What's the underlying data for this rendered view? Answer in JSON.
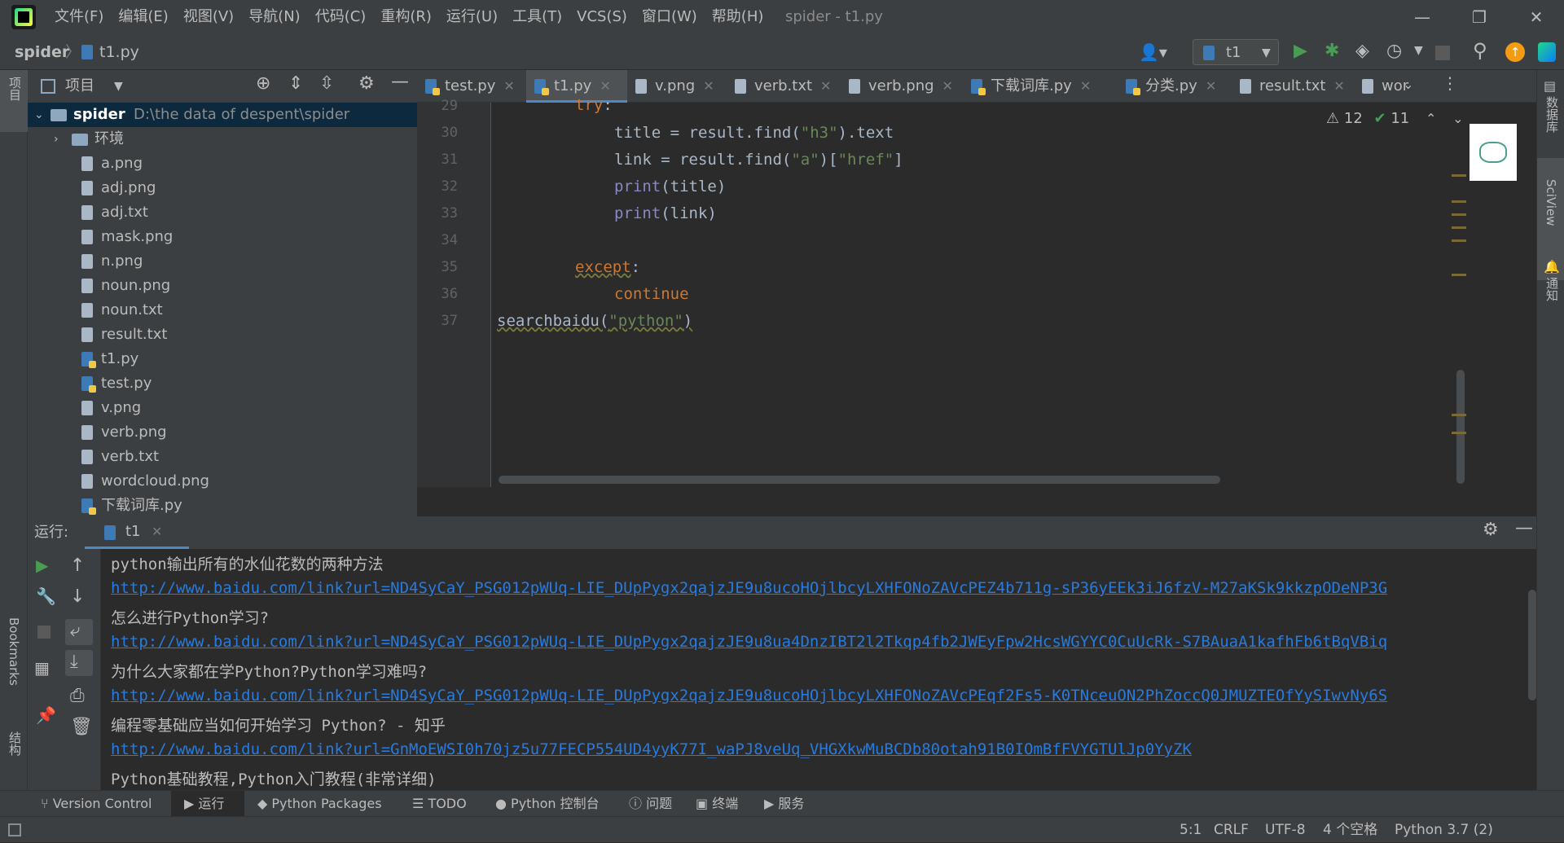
{
  "window": {
    "title": "spider - t1.py",
    "menu": [
      "文件(F)",
      "编辑(E)",
      "视图(V)",
      "导航(N)",
      "代码(C)",
      "重构(R)",
      "运行(U)",
      "工具(T)",
      "VCS(S)",
      "窗口(W)",
      "帮助(H)"
    ]
  },
  "nav": {
    "project": "spider",
    "file": "t1.py",
    "run_config": "t1"
  },
  "left_strip": {
    "project_label": "项目",
    "bookmarks_label": "Bookmarks",
    "structure_label": "结构"
  },
  "right_strip": {
    "db_label": "数据库",
    "sciview_label": "SciView",
    "notify_label": "通知"
  },
  "project_panel": {
    "title": "项目",
    "root_name": "spider",
    "root_path": "D:\\the data of despent\\spider",
    "folder": "环境",
    "files": [
      {
        "name": "a.png",
        "py": false
      },
      {
        "name": "adj.png",
        "py": false
      },
      {
        "name": "adj.txt",
        "py": false
      },
      {
        "name": "mask.png",
        "py": false
      },
      {
        "name": "n.png",
        "py": false
      },
      {
        "name": "noun.png",
        "py": false
      },
      {
        "name": "noun.txt",
        "py": false
      },
      {
        "name": "result.txt",
        "py": false
      },
      {
        "name": "t1.py",
        "py": true
      },
      {
        "name": "test.py",
        "py": true
      },
      {
        "name": "v.png",
        "py": false
      },
      {
        "name": "verb.png",
        "py": false
      },
      {
        "name": "verb.txt",
        "py": false
      },
      {
        "name": "wordcloud.png",
        "py": false
      },
      {
        "name": "下载词库.py",
        "py": true
      }
    ]
  },
  "tabs": [
    "test.py",
    "t1.py",
    "v.png",
    "verb.txt",
    "verb.png",
    "下载词库.py",
    "分类.py",
    "result.txt",
    "wor"
  ],
  "active_tab": "t1.py",
  "inspections": {
    "warnings": "12",
    "ok": "11"
  },
  "code": {
    "line_numbers": [
      "29",
      "30",
      "31",
      "32",
      "33",
      "34",
      "35",
      "36",
      "37"
    ]
  },
  "run": {
    "label": "运行:",
    "tab": "t1",
    "output": [
      {
        "kind": "txt",
        "text": "python输出所有的水仙花数的两种方法"
      },
      {
        "kind": "link",
        "text": "http://www.baidu.com/link?url=ND4SyCaY_PSG012pWUq-LIE_DUpPygx2qajzJE9u8ucoHOjlbcyLXHFONoZAVcPEZ4b711g-sP36yEEk3iJ6fzV-M27aKSk9kkzpODeNP3G"
      },
      {
        "kind": "txt",
        "text": "怎么进行Python学习?"
      },
      {
        "kind": "link",
        "text": "http://www.baidu.com/link?url=ND4SyCaY_PSG012pWUq-LIE_DUpPygx2qajzJE9u8ua4DnzIBT2l2Tkqp4fb2JWEyFpw2HcsWGYYC0CuUcRk-S7BAuaA1kafhFb6tBqVBiq"
      },
      {
        "kind": "txt",
        "text": "为什么大家都在学Python?Python学习难吗?"
      },
      {
        "kind": "link",
        "text": "http://www.baidu.com/link?url=ND4SyCaY_PSG012pWUq-LIE_DUpPygx2qajzJE9u8ucoHOjlbcyLXHFONoZAVcPEqf2Fs5-K0TNceuON2PhZoccQ0JMUZTEOfYySIwvNy6S"
      },
      {
        "kind": "txt",
        "text": "编程零基础应当如何开始学习 Python? - 知乎"
      },
      {
        "kind": "link",
        "text": "http://www.baidu.com/link?url=GnMoEWSI0h70jz5u77FECP554UD4yyK77I_waPJ8veUq_VHGXkwMuBCDb80otah91B0IOmBfFVYGTUlJp0YyZK"
      },
      {
        "kind": "txt",
        "text": "Python基础教程,Python入门教程(非常详细)"
      }
    ]
  },
  "bottom_tools": [
    "Version Control",
    "运行",
    "Python Packages",
    "TODO",
    "Python 控制台",
    "问题",
    "终端",
    "服务"
  ],
  "status": {
    "pos": "5:1",
    "eol": "CRLF",
    "enc": "UTF-8",
    "indent": "4 个空格",
    "interpreter": "Python 3.7 (2)"
  },
  "colors": {
    "accent": "#4a88c7",
    "link": "#287bde",
    "keyword": "#cc7832",
    "string": "#6a8759",
    "run_green": "#499c54"
  }
}
